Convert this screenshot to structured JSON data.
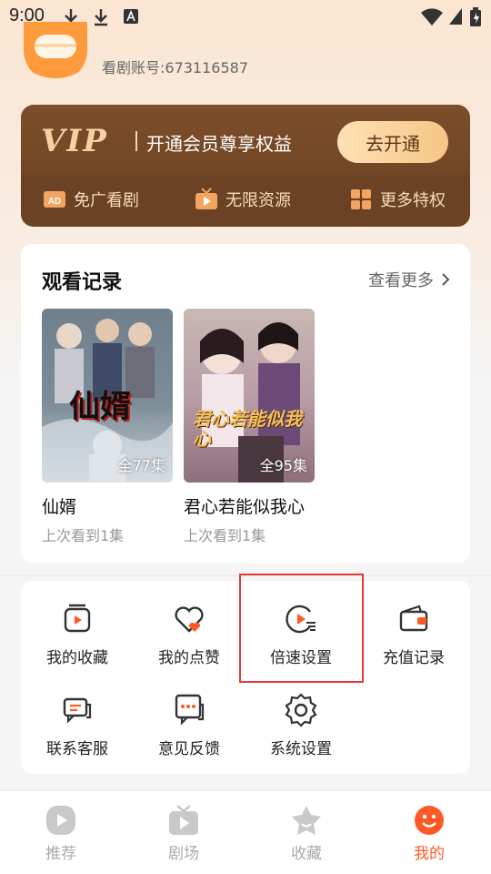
{
  "status_bar": {
    "time": "9:00"
  },
  "profile": {
    "account_text": "看剧账号:673116587"
  },
  "vip": {
    "logo_text": "VIP",
    "slogan": "开通会员尊享权益",
    "button_label": "去开通",
    "perks": [
      {
        "label": "免广看剧",
        "icon": "ad-free-icon"
      },
      {
        "label": "无限资源",
        "icon": "tv-play-icon"
      },
      {
        "label": "更多特权",
        "icon": "grid-icon"
      }
    ]
  },
  "history": {
    "title": "观看记录",
    "more_label": "查看更多",
    "items": [
      {
        "poster_text": "仙婿",
        "episodes": "全77集",
        "title": "仙婿",
        "progress": "上次看到1集"
      },
      {
        "poster_text": "君心若能似我心",
        "episodes": "全95集",
        "title": "君心若能似我心",
        "progress": "上次看到1集"
      }
    ]
  },
  "menu": {
    "items": [
      {
        "label": "我的收藏",
        "icon": "favorites-icon"
      },
      {
        "label": "我的点赞",
        "icon": "likes-icon"
      },
      {
        "label": "倍速设置",
        "icon": "playback-speed-icon"
      },
      {
        "label": "充值记录",
        "icon": "wallet-icon"
      },
      {
        "label": "联系客服",
        "icon": "customer-service-icon"
      },
      {
        "label": "意见反馈",
        "icon": "feedback-icon"
      },
      {
        "label": "系统设置",
        "icon": "settings-gear-icon"
      }
    ]
  },
  "bottom_nav": {
    "items": [
      {
        "label": "推荐",
        "icon": "play-circle-icon",
        "active": false
      },
      {
        "label": "剧场",
        "icon": "tv-icon",
        "active": false
      },
      {
        "label": "收藏",
        "icon": "star-icon",
        "active": false
      },
      {
        "label": "我的",
        "icon": "smiley-icon",
        "active": true
      }
    ]
  },
  "colors": {
    "accent": "#ff5a26",
    "vip_brown": "#6b4223",
    "vip_gold": "#f6c585",
    "highlight_red": "#e53935"
  }
}
